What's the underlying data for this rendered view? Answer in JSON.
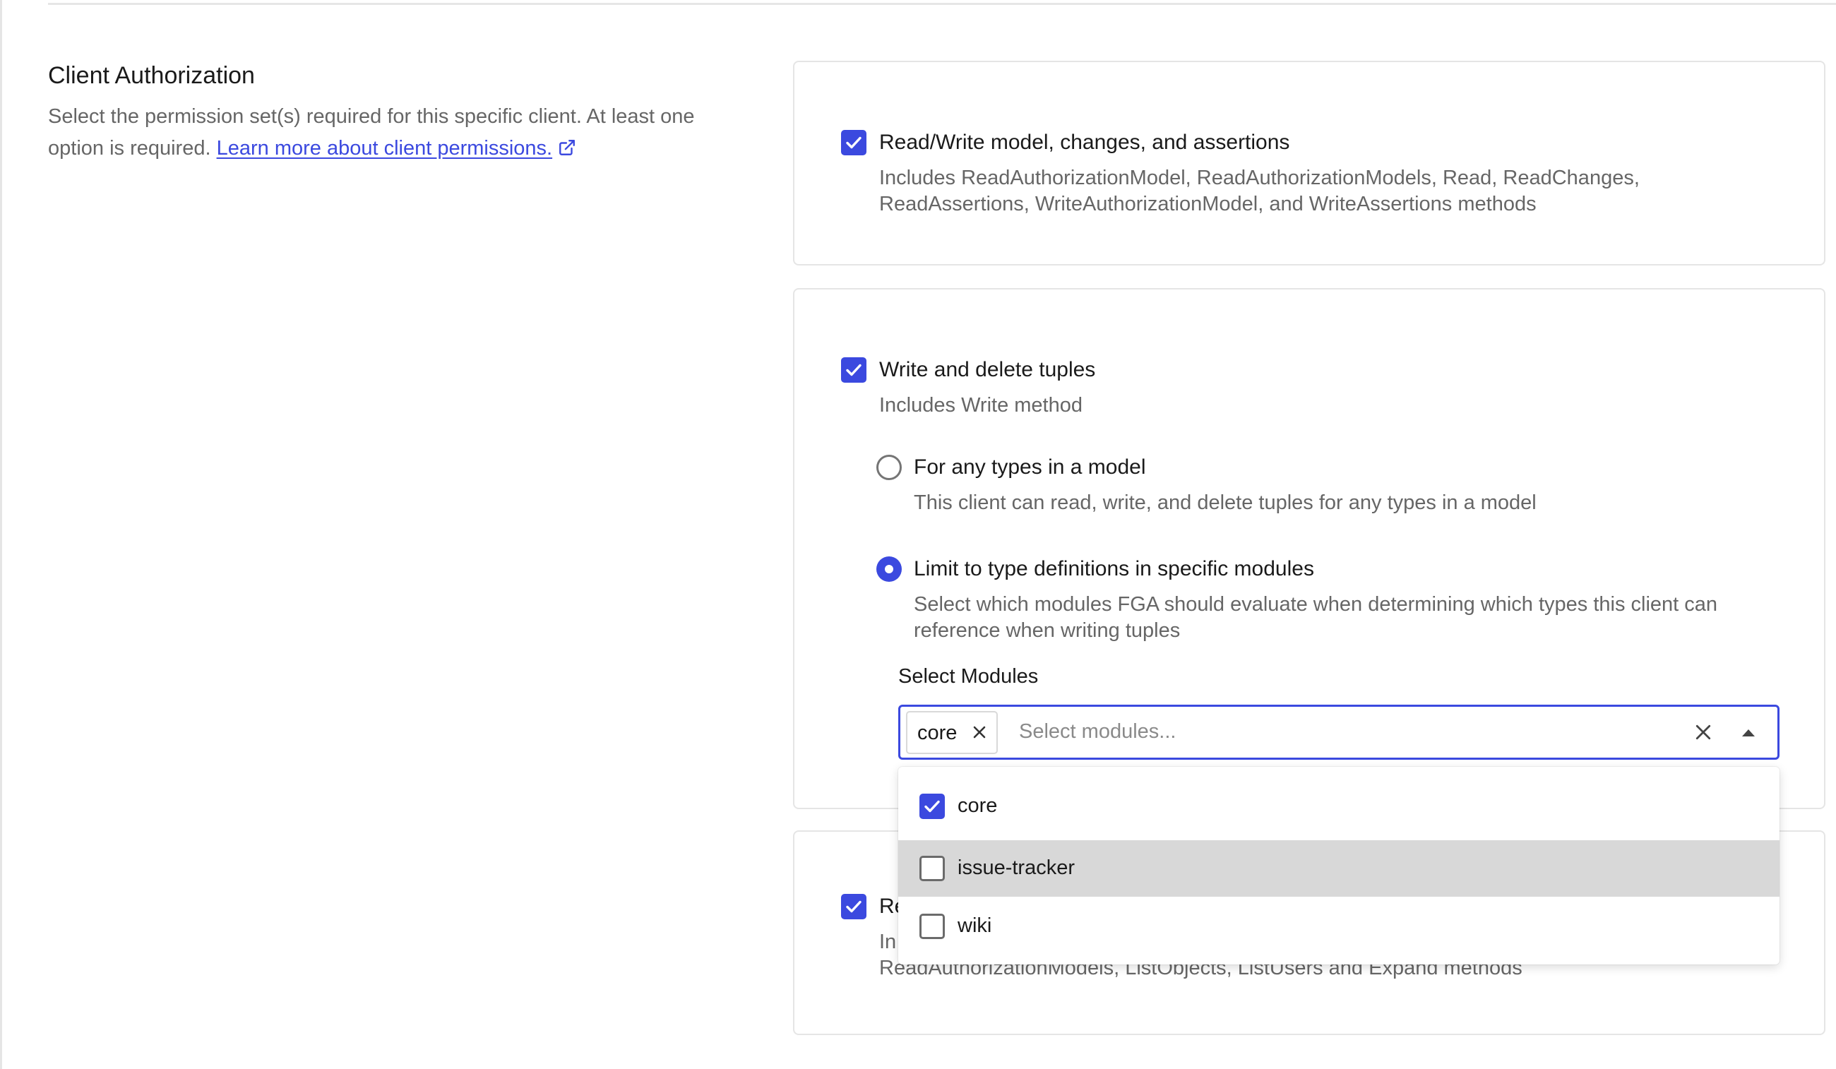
{
  "section": {
    "title": "Client Authorization",
    "description": "Select the permission set(s) required for this specific client. At least one option is required.",
    "learn_more_link": "Learn more about client permissions."
  },
  "permissions": [
    {
      "label": "Read/Write model, changes, and assertions",
      "description": "Includes ReadAuthorizationModel, ReadAuthorizationModels, Read, ReadChanges, ReadAssertions, WriteAuthorizationModel, and WriteAssertions methods",
      "checked": true
    },
    {
      "label": "Write and delete tuples",
      "description": "Includes Write method",
      "checked": true,
      "scope_options": [
        {
          "label": "For any types in a model",
          "description": "This client can read, write, and delete tuples for any types in a model",
          "selected": false
        },
        {
          "label": "Limit to type definitions in specific modules",
          "description": "Select which modules FGA should evaluate when determining which types this client can reference when writing tuples",
          "selected": true
        }
      ],
      "module_select": {
        "label": "Select Modules",
        "placeholder": "Select modules...",
        "selected_chips": [
          "core"
        ],
        "options": [
          {
            "label": "core",
            "checked": true
          },
          {
            "label": "issue-tracker",
            "checked": false,
            "highlighted": true
          },
          {
            "label": "wiki",
            "checked": false
          }
        ]
      }
    },
    {
      "label_visible": "Re",
      "description_line1_visible": "In",
      "description_line2_visible": "ReadAuthorizationModels, ListObjects, ListUsers and Expand methods",
      "checked": true
    }
  ],
  "colors": {
    "accent": "#3b49df",
    "border": "#e5e5e5",
    "muted_text": "#666666",
    "highlight": "#d8d8d8"
  },
  "icons": {
    "link": "external-link-icon",
    "check": "checkmark-icon",
    "remove_chip": "close-icon",
    "clear": "clear-icon",
    "toggle": "caret-up-icon"
  }
}
